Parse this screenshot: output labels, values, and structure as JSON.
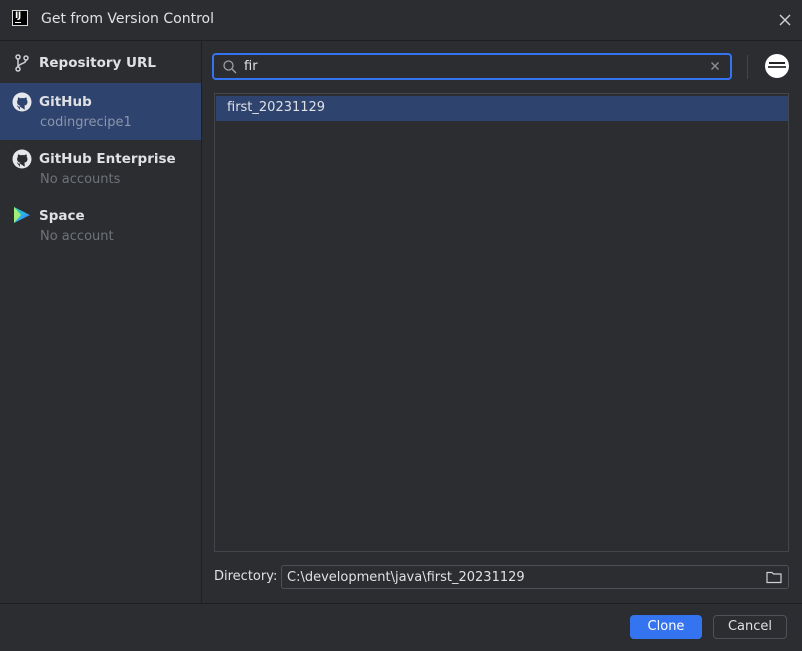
{
  "window": {
    "title": "Get from Version Control",
    "app_icon": "intellij-idea-icon",
    "close_icon": "close-icon"
  },
  "sidebar": {
    "items": [
      {
        "title": "Repository URL",
        "subtitle": "",
        "icon": "git-branch-icon",
        "selected": false
      },
      {
        "title": "GitHub",
        "subtitle": "codingrecipe1",
        "icon": "github-icon",
        "selected": true
      },
      {
        "title": "GitHub Enterprise",
        "subtitle": "No accounts",
        "icon": "github-icon",
        "selected": false
      },
      {
        "title": "Space",
        "subtitle": "No account",
        "icon": "jetbrains-space-icon",
        "selected": false
      }
    ]
  },
  "search": {
    "value": "fir",
    "icon": "search-icon",
    "clear_icon": "clear-icon"
  },
  "account": {
    "avatar_icon": "user-avatar-icon"
  },
  "repositories": [
    {
      "name": "first_20231129",
      "selected": true
    }
  ],
  "directory": {
    "label": "Directory:",
    "value": "C:\\development\\java\\first_20231129",
    "browse_icon": "folder-icon"
  },
  "buttons": {
    "clone": "Clone",
    "cancel": "Cancel"
  },
  "colors": {
    "background": "#2b2d30",
    "selection": "#2e436e",
    "accent": "#3574f0",
    "border": "#43454a",
    "text": "#dfe1e5",
    "muted_text": "#6f737a"
  }
}
